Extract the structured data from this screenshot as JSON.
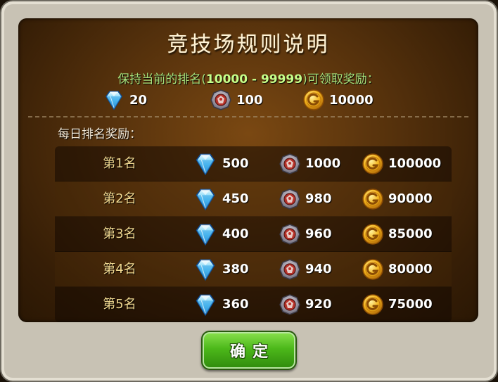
{
  "dialog": {
    "title": "竞技场规则说明",
    "keep_prefix": "保持当前的排名(",
    "keep_range": "10000 - 99999",
    "keep_suffix": ")可领取奖励：",
    "keep_rewards": {
      "gem": "20",
      "medal": "100",
      "gold": "10000"
    },
    "daily_label": "每日排名奖励：",
    "ranks": [
      {
        "label": "第1名",
        "gem": "500",
        "medal": "1000",
        "gold": "100000"
      },
      {
        "label": "第2名",
        "gem": "450",
        "medal": "980",
        "gold": "90000"
      },
      {
        "label": "第3名",
        "gem": "400",
        "medal": "960",
        "gold": "85000"
      },
      {
        "label": "第4名",
        "gem": "380",
        "medal": "940",
        "gold": "80000"
      },
      {
        "label": "第5名",
        "gem": "360",
        "medal": "920",
        "gold": "75000"
      }
    ],
    "confirm_label": "确定"
  },
  "icons": {
    "gem": "diamond-gem-icon",
    "medal": "medal-badge-icon",
    "gold": "gold-coin-icon"
  },
  "colors": {
    "keep_text": "#a6e07a",
    "rank_text": "#f0d890",
    "button": "#4cb81a",
    "panel": "#55310c"
  }
}
